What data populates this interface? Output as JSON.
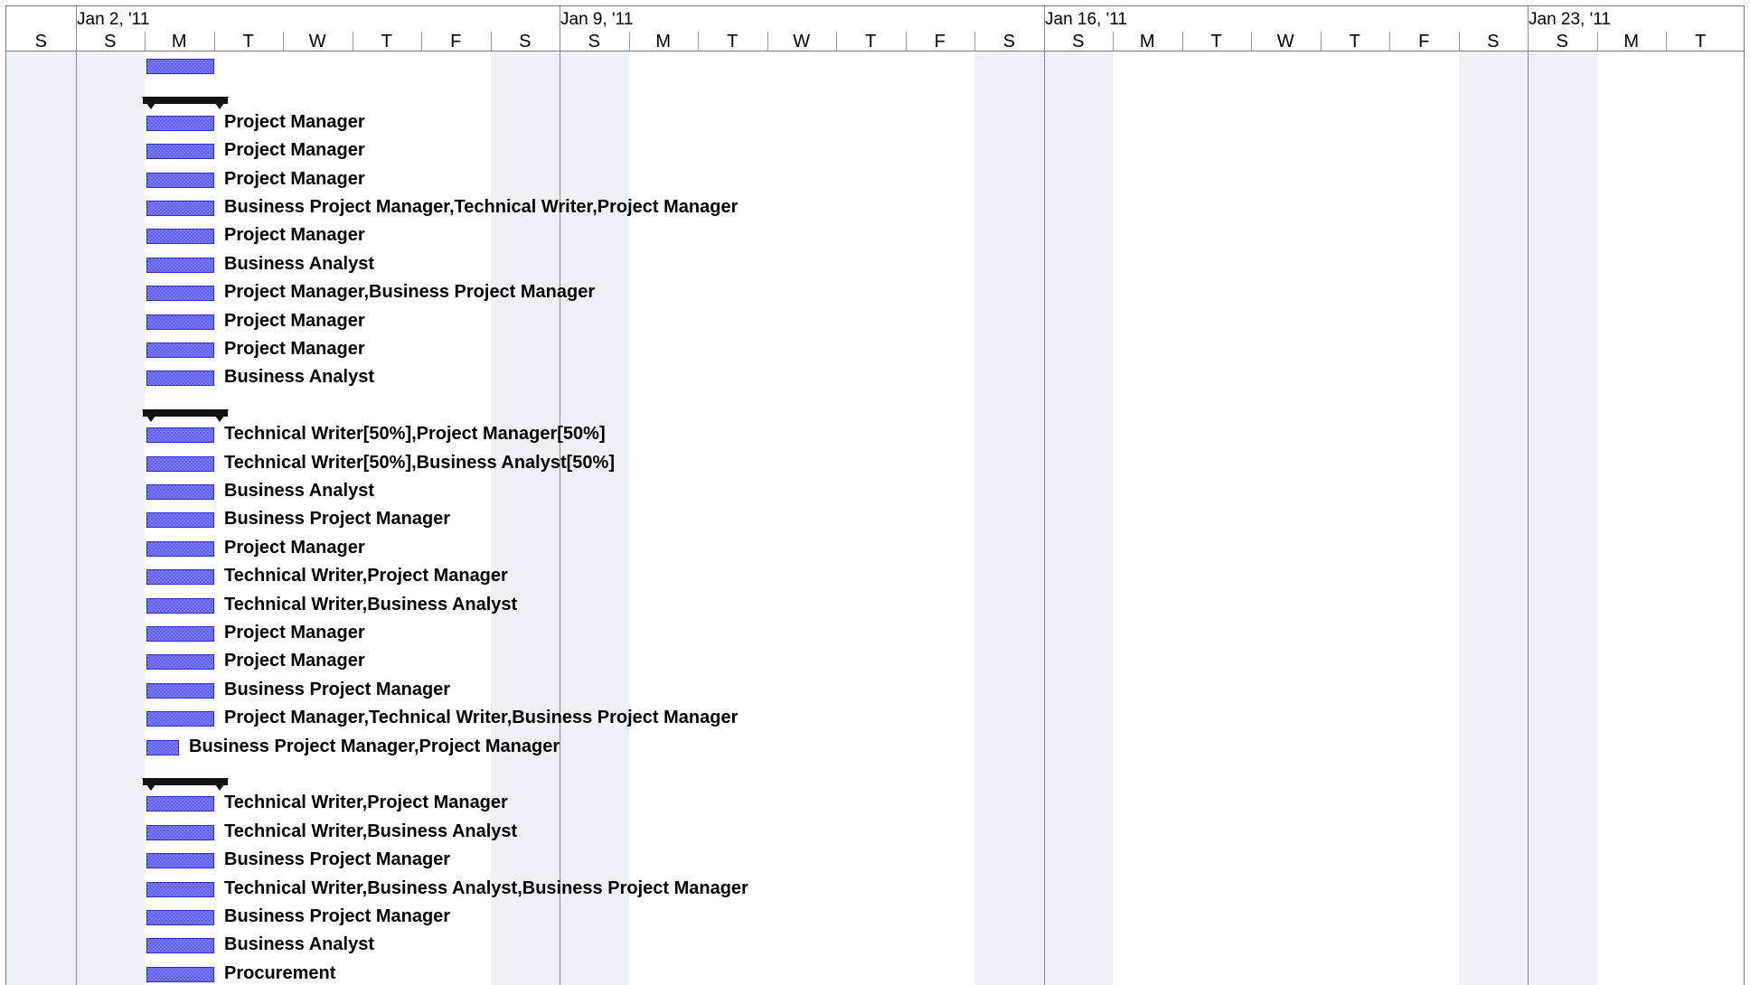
{
  "timescale": {
    "weeks": [
      "Jan 2, '11",
      "Jan 9, '11",
      "Jan 16, '11",
      "Jan 23, '11"
    ],
    "days": [
      "S",
      "S",
      "M",
      "T",
      "W",
      "T",
      "F",
      "S",
      "S",
      "M",
      "T",
      "W",
      "T",
      "F",
      "S",
      "S",
      "M",
      "T",
      "W",
      "T",
      "F",
      "S",
      "S",
      "M",
      "T"
    ],
    "weekend_day_indices": [
      0,
      1,
      7,
      8,
      14,
      15,
      21,
      22
    ]
  },
  "colors": {
    "task_bar": "#8080ff",
    "task_bar_border": "#2c2cd6",
    "summary_bar": "#111111",
    "weekend_shading": "#eef1f6"
  },
  "rows": [
    {
      "type": "task",
      "duration_days": 1,
      "resources": ""
    },
    {
      "type": "summary"
    },
    {
      "type": "task",
      "duration_days": 1,
      "resources": "Project Manager"
    },
    {
      "type": "task",
      "duration_days": 1,
      "resources": "Project Manager"
    },
    {
      "type": "task",
      "duration_days": 1,
      "resources": "Project Manager"
    },
    {
      "type": "task",
      "duration_days": 1,
      "resources": "Business Project Manager,Technical Writer,Project Manager"
    },
    {
      "type": "task",
      "duration_days": 1,
      "resources": "Project Manager"
    },
    {
      "type": "task",
      "duration_days": 1,
      "resources": "Business Analyst"
    },
    {
      "type": "task",
      "duration_days": 1,
      "resources": "Project Manager,Business Project Manager"
    },
    {
      "type": "task",
      "duration_days": 1,
      "resources": "Project Manager"
    },
    {
      "type": "task",
      "duration_days": 1,
      "resources": "Project Manager"
    },
    {
      "type": "task",
      "duration_days": 1,
      "resources": "Business Analyst"
    },
    {
      "type": "summary"
    },
    {
      "type": "task",
      "duration_days": 1,
      "resources": "Technical Writer[50%],Project Manager[50%]"
    },
    {
      "type": "task",
      "duration_days": 1,
      "resources": "Technical Writer[50%],Business Analyst[50%]"
    },
    {
      "type": "task",
      "duration_days": 1,
      "resources": "Business Analyst"
    },
    {
      "type": "task",
      "duration_days": 1,
      "resources": "Business Project Manager"
    },
    {
      "type": "task",
      "duration_days": 1,
      "resources": "Project Manager"
    },
    {
      "type": "task",
      "duration_days": 1,
      "resources": "Technical Writer,Project Manager"
    },
    {
      "type": "task",
      "duration_days": 1,
      "resources": "Technical Writer,Business Analyst"
    },
    {
      "type": "task",
      "duration_days": 1,
      "resources": "Project Manager"
    },
    {
      "type": "task",
      "duration_days": 1,
      "resources": "Project Manager"
    },
    {
      "type": "task",
      "duration_days": 1,
      "resources": "Business Project Manager"
    },
    {
      "type": "task",
      "duration_days": 1,
      "resources": "Project Manager,Technical Writer,Business Project Manager"
    },
    {
      "type": "task",
      "duration_days": 0.5,
      "resources": "Business Project Manager,Project Manager"
    },
    {
      "type": "summary"
    },
    {
      "type": "task",
      "duration_days": 1,
      "resources": "Technical Writer,Project Manager"
    },
    {
      "type": "task",
      "duration_days": 1,
      "resources": "Technical Writer,Business Analyst"
    },
    {
      "type": "task",
      "duration_days": 1,
      "resources": "Business Project Manager"
    },
    {
      "type": "task",
      "duration_days": 1,
      "resources": "Technical Writer,Business Analyst,Business Project Manager"
    },
    {
      "type": "task",
      "duration_days": 1,
      "resources": "Business Project Manager"
    },
    {
      "type": "task",
      "duration_days": 1,
      "resources": "Business Analyst"
    },
    {
      "type": "task",
      "duration_days": 1,
      "resources": "Procurement"
    }
  ]
}
